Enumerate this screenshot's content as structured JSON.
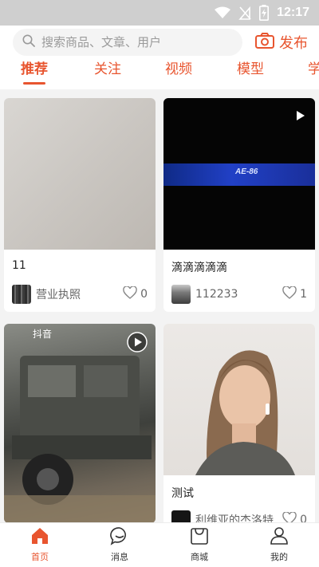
{
  "status_bar": {
    "time": "12:17"
  },
  "search": {
    "placeholder": "搜索商品、文章、用户"
  },
  "publish": {
    "label": "发布"
  },
  "tabs": [
    {
      "label": "推荐"
    },
    {
      "label": "关注"
    },
    {
      "label": "视频"
    },
    {
      "label": "模型"
    },
    {
      "label": "学"
    }
  ],
  "feed": [
    {
      "title": "11",
      "author": "营业执照",
      "likes": "0"
    },
    {
      "title": "滴滴滴滴滴",
      "author": "112233",
      "likes": "1",
      "badge_text": "AE-86"
    },
    {
      "title": "",
      "author": "",
      "likes": "",
      "watermark": "抖音"
    },
    {
      "title": "测试",
      "author": "利维亚的杰洛特",
      "likes": "0"
    }
  ],
  "bottom_nav": [
    {
      "label": "首页"
    },
    {
      "label": "消息"
    },
    {
      "label": "商城"
    },
    {
      "label": "我的"
    }
  ],
  "colors": {
    "accent": "#e8552f"
  }
}
